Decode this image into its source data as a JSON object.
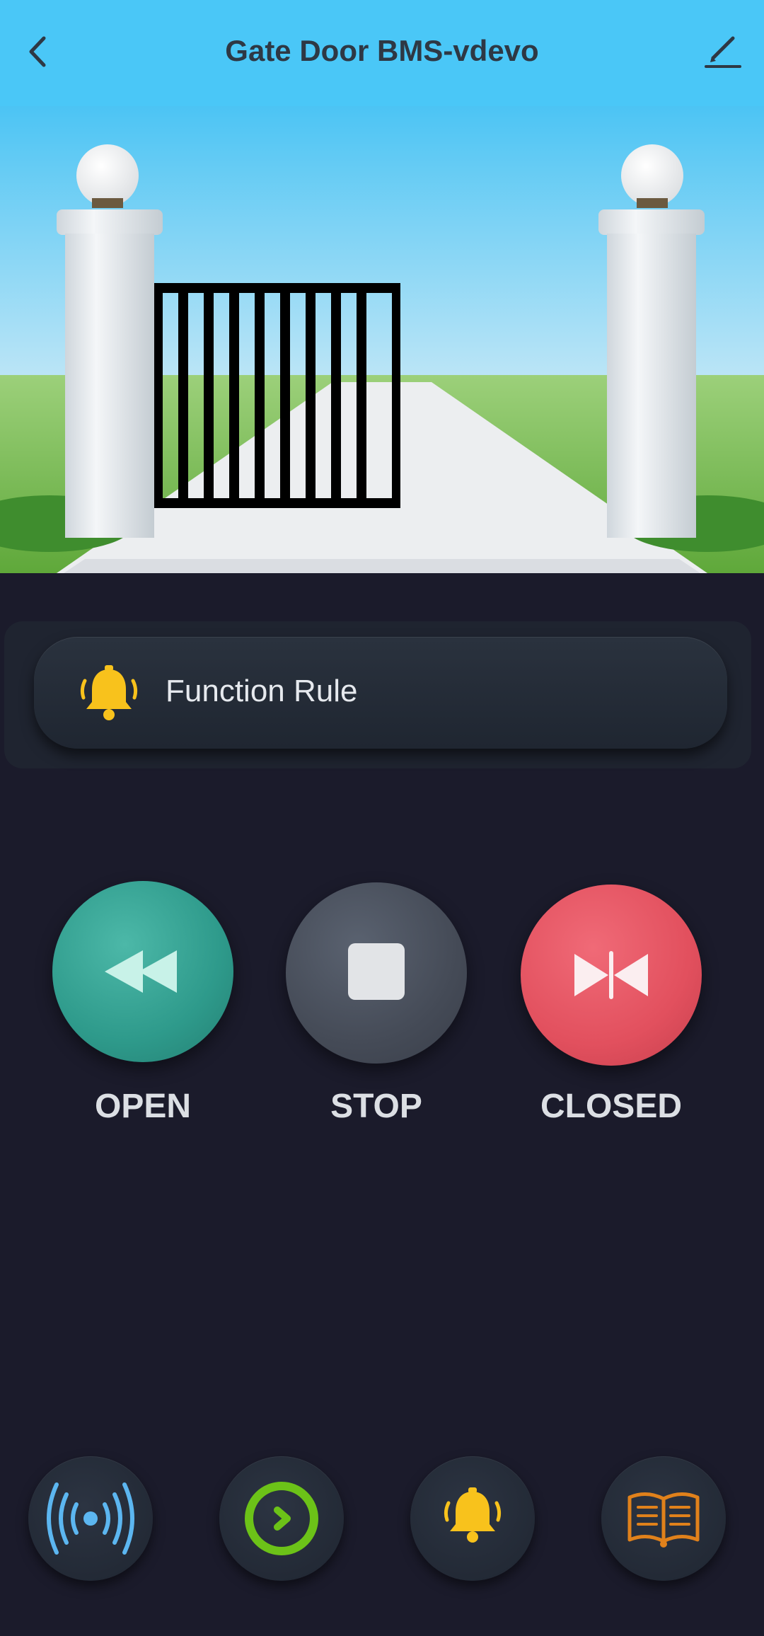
{
  "header": {
    "title": "Gate Door BMS-vdevo",
    "back_icon": "back-chevron-icon",
    "edit_icon": "edit-pencil-icon"
  },
  "scene": {
    "description_icon": "gate-illustration"
  },
  "function_rule": {
    "label": "Function Rule",
    "icon": "bell-icon",
    "icon_color": "#f8c21c"
  },
  "controls": {
    "open": {
      "label": "OPEN",
      "icon": "rewind-icon",
      "color": "#2e9a8b"
    },
    "stop": {
      "label": "STOP",
      "icon": "stop-icon",
      "color": "#454b57"
    },
    "close": {
      "label": "CLOSED",
      "icon": "close-gate-icon",
      "color": "#e2505e"
    }
  },
  "bottom_nav": [
    {
      "icon": "broadcast-signal-icon",
      "color": "#5cb6f0"
    },
    {
      "icon": "timer-ring-icon",
      "color": "#6cc218"
    },
    {
      "icon": "alarm-bell-icon",
      "color": "#f8c21c"
    },
    {
      "icon": "manual-book-icon",
      "color": "#e0811b"
    }
  ]
}
